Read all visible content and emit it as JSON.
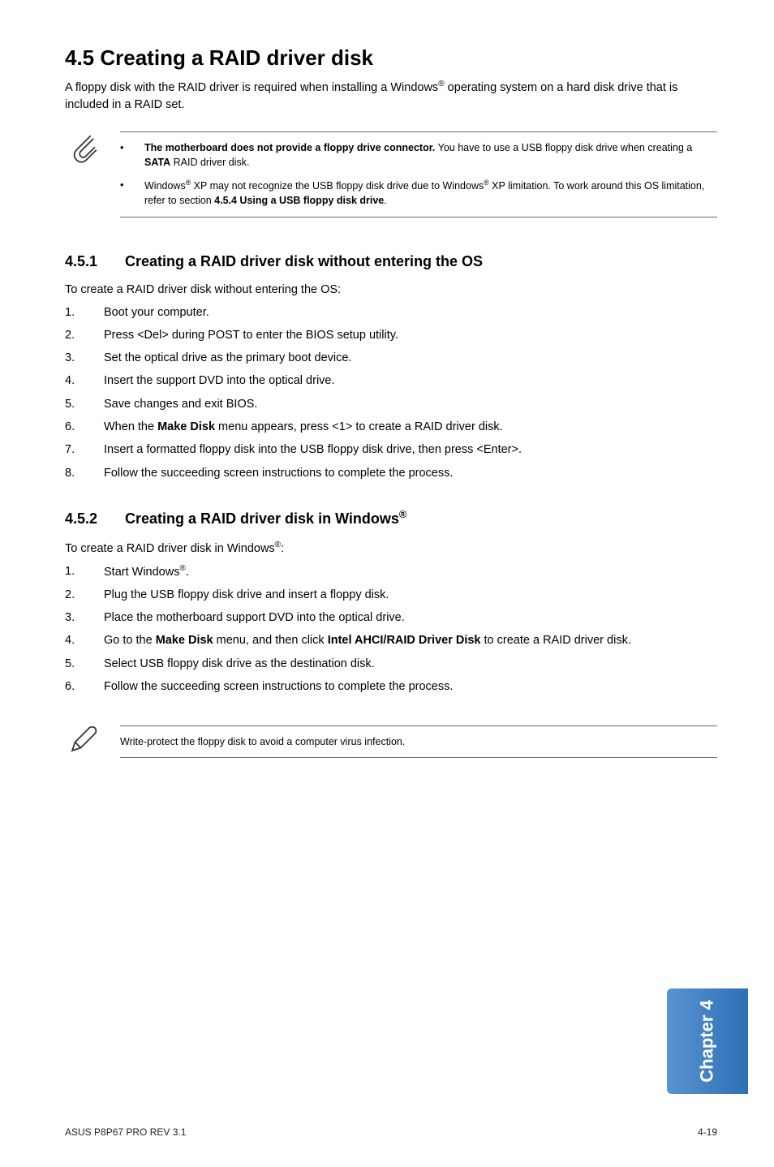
{
  "h1": "4.5     Creating a RAID driver disk",
  "intro_pre": "A floppy disk with the RAID driver is required when installing a Windows",
  "intro_sup": "®",
  "intro_post": " operating system on a hard disk drive that is included in a RAID set.",
  "note1": {
    "b1_bold": "The motherboard does not provide a floppy drive connector.",
    "b1_rest_pre": " You have to use a USB floppy disk drive when creating a ",
    "b1_rest_bold": "SATA",
    "b1_rest_post": " RAID driver disk.",
    "b2_pre": "Windows",
    "b2_sup1": "®",
    "b2_mid": " XP may not recognize the USB floppy disk drive due to Windows",
    "b2_sup2": "®",
    "b2_mid2": " XP limitation. To work around this OS limitation, refer to section ",
    "b2_bold": "4.5.4 Using a USB floppy disk drive",
    "b2_end": "."
  },
  "sec451": {
    "num": "4.5.1",
    "title": "Creating a RAID driver disk without entering the OS",
    "intro": "To create a RAID driver disk without entering the OS:",
    "steps": [
      "Boot your computer.",
      "Press <Del> during POST to enter the BIOS setup utility.",
      "Set the optical drive as the primary boot device.",
      "Insert the support DVD into the optical drive.",
      "Save changes and exit BIOS.",
      "When the __B__Make Disk__/B__ menu appears, press <1> to create a RAID driver disk.",
      "Insert a formatted floppy disk into the USB floppy disk drive, then press <Enter>.",
      "Follow the succeeding screen instructions to complete the process."
    ]
  },
  "sec452": {
    "num": "4.5.2",
    "title_pre": "Creating a RAID driver disk in Windows",
    "title_sup": "®",
    "intro_pre": "To create a RAID driver disk in Windows",
    "intro_sup": "®",
    "intro_post": ":",
    "steps": [
      "Start Windows__SUP__®__/SUP__.",
      "Plug the USB floppy disk drive and insert a floppy disk.",
      "Place the motherboard support DVD into the optical drive.",
      "Go to the __B__Make Disk__/B__ menu, and then click __B__Intel AHCI/RAID Driver Disk__/B__ to create a RAID driver disk.",
      "Select USB floppy disk drive as the destination disk.",
      "Follow the succeeding screen instructions to complete the process."
    ]
  },
  "note2": "Write-protect the floppy disk to avoid a computer virus infection.",
  "side_tab": "Chapter 4",
  "footer_left": "ASUS P8P67 PRO REV 3.1",
  "footer_right": "4-19"
}
